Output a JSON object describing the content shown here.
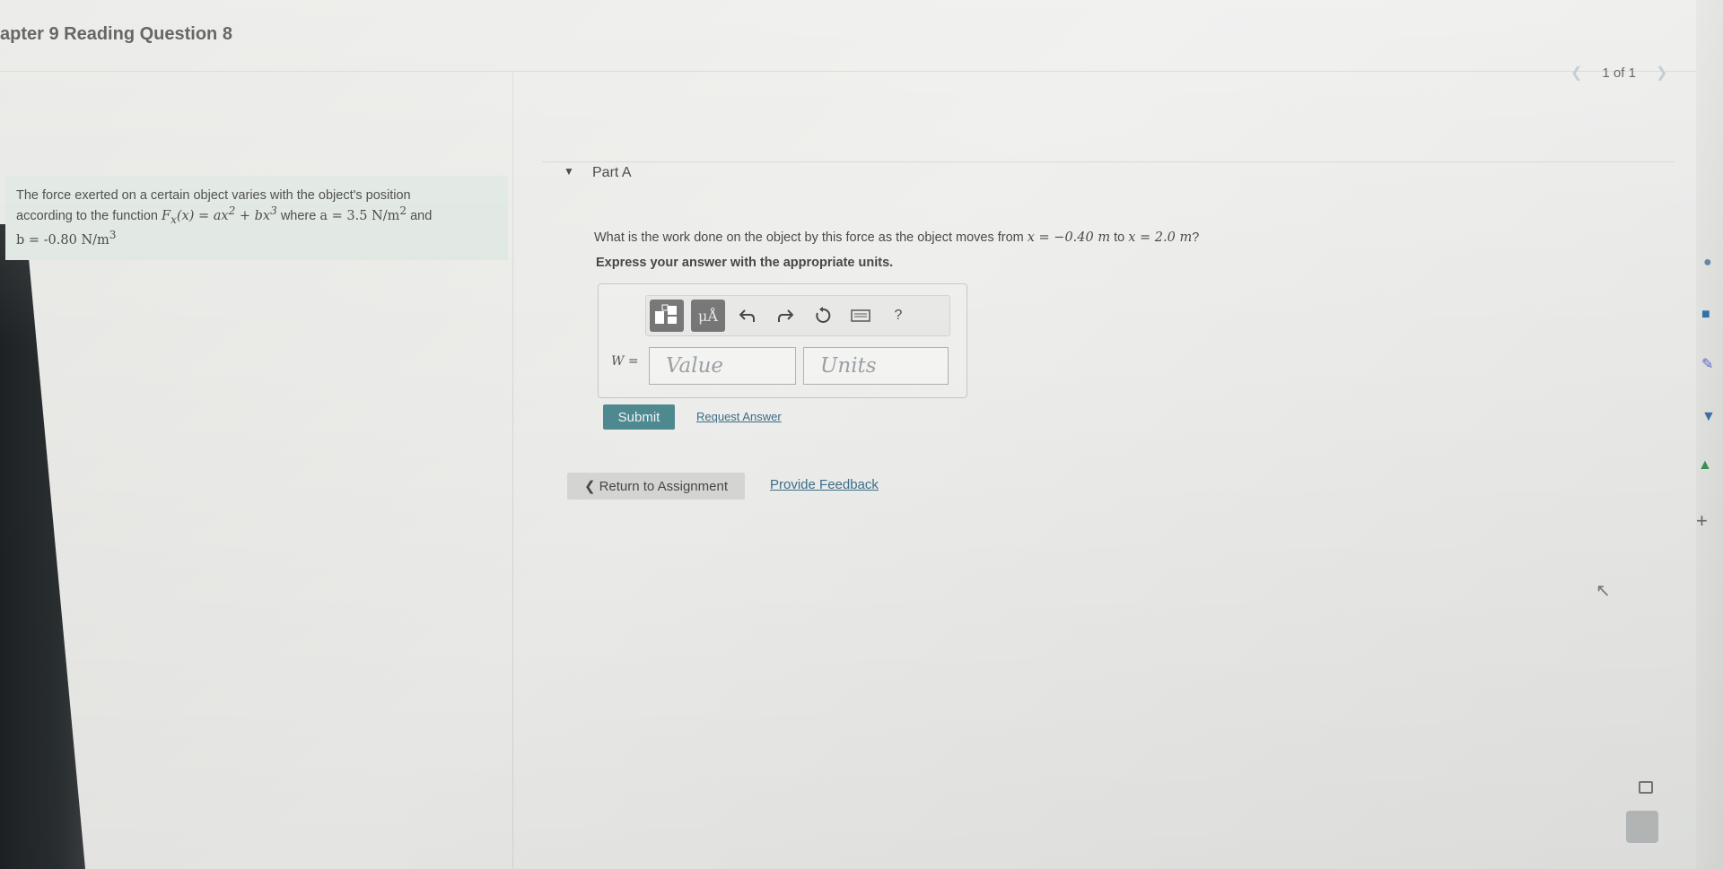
{
  "header": {
    "title": "apter 9 Reading Question 8",
    "pager_text": "1 of 1"
  },
  "problem": {
    "text_part1": "The force exerted on a certain object varies with the object's position",
    "text_part2": "according to the function",
    "function": "F",
    "function_sub": "x",
    "function_expr": "(x) = ax",
    "exp2": "2",
    "plus": " + bx",
    "exp3": "3",
    "where": "where",
    "a_eq": "a = 3.5",
    "a_unit": "N/m",
    "a_unit_exp": "2",
    "and": "and",
    "b_eq": "b = -0.80",
    "b_unit": "N/m",
    "b_unit_exp": "3"
  },
  "partA": {
    "label": "Part A",
    "question_prefix": "What is the work done on the object by this force as the object moves from",
    "x1": "x = −0.40 m",
    "to": "to",
    "x2": "x = 2.0 m",
    "question_suffix": "?",
    "instruction": "Express your answer with the appropriate units.",
    "variable": "W",
    "equals": " =",
    "value_placeholder": "Value",
    "units_placeholder": "Units",
    "submit_label": "Submit",
    "request_label": "Request Answer",
    "mu_label": "μÅ",
    "help_label": "?"
  },
  "footer": {
    "return_label": "Return to Assignment",
    "feedback_label": "Provide Feedback"
  },
  "colors": {
    "submit_bg": "#4f8a91",
    "problem_bg": "#dfe7e2",
    "link": "#3d6e88"
  },
  "icons": {
    "undo": "undo-icon",
    "redo": "redo-icon",
    "reset": "reset-icon",
    "keyboard": "keyboard-icon",
    "template": "template-icon"
  }
}
